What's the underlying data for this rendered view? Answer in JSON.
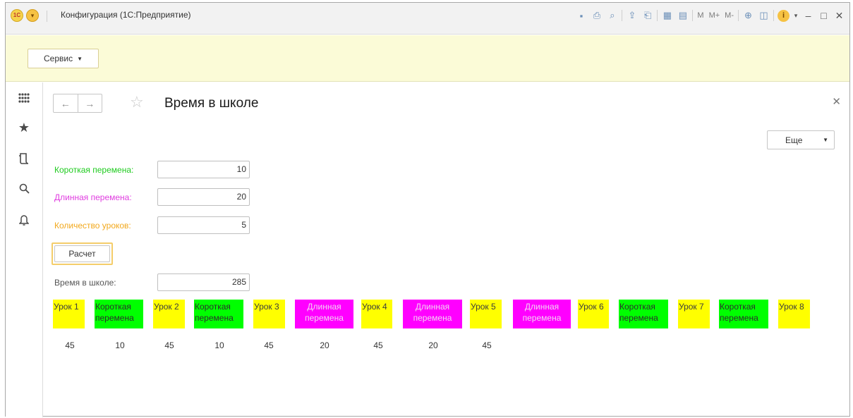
{
  "window": {
    "title": "Конфигурация  (1С:Предприятие)",
    "logo_text": "1С",
    "toolbar_icons": [
      "save-icon",
      "print-icon",
      "preview-icon",
      "export-icon",
      "print2-icon",
      "calculator-icon",
      "calendar-icon"
    ],
    "memory_buttons": {
      "m": "M",
      "m_plus": "M+",
      "m_minus": "M-"
    },
    "controls": {
      "minimize": "–",
      "maximize": "□",
      "close": "✕"
    }
  },
  "cmdbar": {
    "servis_label": "Сервис"
  },
  "sidebar": {
    "items": [
      "apps-grid-icon",
      "favorites-star-icon",
      "history-icon",
      "search-icon",
      "notifications-bell-icon"
    ]
  },
  "form": {
    "title": "Время в школе",
    "more_label": "Еще",
    "fields": {
      "short_break": {
        "label": "Короткая перемена:",
        "value": "10"
      },
      "long_break": {
        "label": "Длинная перемена:",
        "value": "20"
      },
      "lesson_count": {
        "label": "Количество уроков:",
        "value": "5"
      },
      "total": {
        "label": "Время в школе:",
        "value": "285"
      }
    },
    "calc_label": "Расчет",
    "schedule": [
      {
        "line1": "Урок 1",
        "line2": ""
      },
      {
        "line1": "Короткая",
        "line2": "перемена"
      },
      {
        "line1": "Урок 2",
        "line2": ""
      },
      {
        "line1": "Короткая",
        "line2": "перемена"
      },
      {
        "line1": "Урок 3",
        "line2": ""
      },
      {
        "line1": "Длинная",
        "line2": "перемена"
      },
      {
        "line1": "Урок 4",
        "line2": ""
      },
      {
        "line1": "Длинная",
        "line2": "перемена"
      },
      {
        "line1": "Урок 5",
        "line2": ""
      },
      {
        "line1": "Длинная",
        "line2": "перемена"
      },
      {
        "line1": "Урок 6",
        "line2": ""
      },
      {
        "line1": "Короткая",
        "line2": "перемена"
      },
      {
        "line1": "Урок 7",
        "line2": ""
      },
      {
        "line1": "Короткая",
        "line2": "перемена"
      },
      {
        "line1": "Урок 8",
        "line2": ""
      }
    ],
    "durations": [
      "45",
      "10",
      "45",
      "10",
      "45",
      "20",
      "45",
      "20",
      "45"
    ]
  },
  "colors": {
    "short_break": "#00ff00",
    "long_break": "#ff00ff",
    "lesson": "#ffff00",
    "label_short": "#1ecb1e",
    "label_long": "#e03ee0",
    "label_count": "#f2a81c",
    "cmdbar_bg": "#fbfbd7"
  }
}
